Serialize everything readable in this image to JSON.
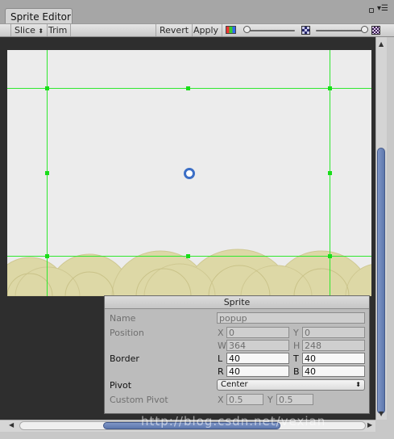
{
  "window": {
    "tab_title": "Sprite Editor"
  },
  "toolbar": {
    "slice_label": "Slice",
    "trim_label": "Trim",
    "revert_label": "Revert",
    "apply_label": "Apply",
    "zoom_slider_value": 0.0,
    "mip_slider_value": 1.0,
    "icons": [
      "color-channels-icon",
      "alpha-checker-icon",
      "mip-checker-icon"
    ]
  },
  "sprite_panel": {
    "title": "Sprite",
    "name_label": "Name",
    "name_value": "popup",
    "position_label": "Position",
    "x_label": "X",
    "x_value": "0",
    "y_label": "Y",
    "y_value": "0",
    "w_label": "W",
    "w_value": "364",
    "h_label": "H",
    "h_value": "248",
    "border_label": "Border",
    "l_label": "L",
    "l_value": "40",
    "t_label": "T",
    "t_value": "40",
    "r_label": "R",
    "r_value": "40",
    "b_label": "B",
    "b_value": "40",
    "pivot_label": "Pivot",
    "pivot_value": "Center",
    "custom_pivot_label": "Custom Pivot",
    "cx_label": "X",
    "cx_value": "0.5",
    "cy_label": "Y",
    "cy_value": "0.5"
  },
  "watermark": "http://blog.csdn.net/vexian",
  "colors": {
    "guide": "#2fe82f",
    "pattern": "#ddd8a6",
    "accent": "#5d77ad"
  }
}
